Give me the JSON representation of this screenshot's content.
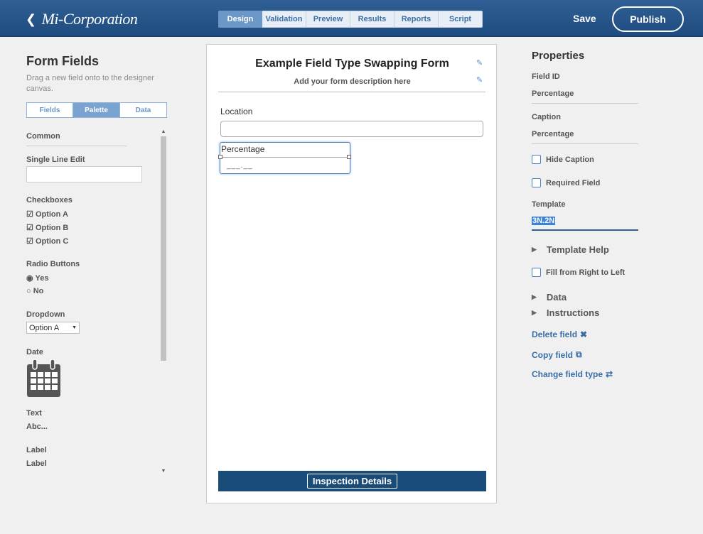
{
  "header": {
    "logo": "Mi-Corporation",
    "back_glyph": "<",
    "tabs": [
      "Design",
      "Validation",
      "Preview",
      "Results",
      "Reports",
      "Script"
    ],
    "active_tab": "Design",
    "save_label": "Save",
    "publish_label": "Publish"
  },
  "left": {
    "title": "Form Fields",
    "description": "Drag a new field onto to the designer canvas.",
    "segments": [
      "Fields",
      "Palette",
      "Data"
    ],
    "active_segment": "Palette",
    "palette": {
      "common": "Common",
      "single_line_edit": "Single Line Edit",
      "checkboxes": "Checkboxes",
      "checkbox_options": [
        "Option A",
        "Option B",
        "Option C"
      ],
      "radio_buttons": "Radio Buttons",
      "radio_options": [
        "Yes",
        "No"
      ],
      "dropdown": "Dropdown",
      "dropdown_value": "Option A",
      "date": "Date",
      "text": "Text",
      "text_sample": "Abc...",
      "label": "Label",
      "label_sample": "Label"
    }
  },
  "canvas": {
    "form_title": "Example Field Type Swapping Form",
    "form_description": "Add your form description here",
    "location_label": "Location",
    "selected_field_caption": "Percentage",
    "selected_field_mask": "___.__",
    "footer_label": "Inspection Details"
  },
  "properties": {
    "title": "Properties",
    "field_id_label": "Field ID",
    "field_id_value": "Percentage",
    "caption_label": "Caption",
    "caption_value": "Percentage",
    "hide_caption": "Hide Caption",
    "required_field": "Required Field",
    "template_label": "Template",
    "template_value": "3N.2N",
    "template_help": "Template Help",
    "fill_rtl": "Fill from Right to Left",
    "data": "Data",
    "instructions": "Instructions",
    "delete_field": "Delete field",
    "copy_field": "Copy field",
    "change_field_type": "Change field type"
  },
  "colors": {
    "header": "#1f4c80",
    "accent": "#6b98c7",
    "footer_bar": "#1a4c7a",
    "link": "#3a6ea8"
  }
}
